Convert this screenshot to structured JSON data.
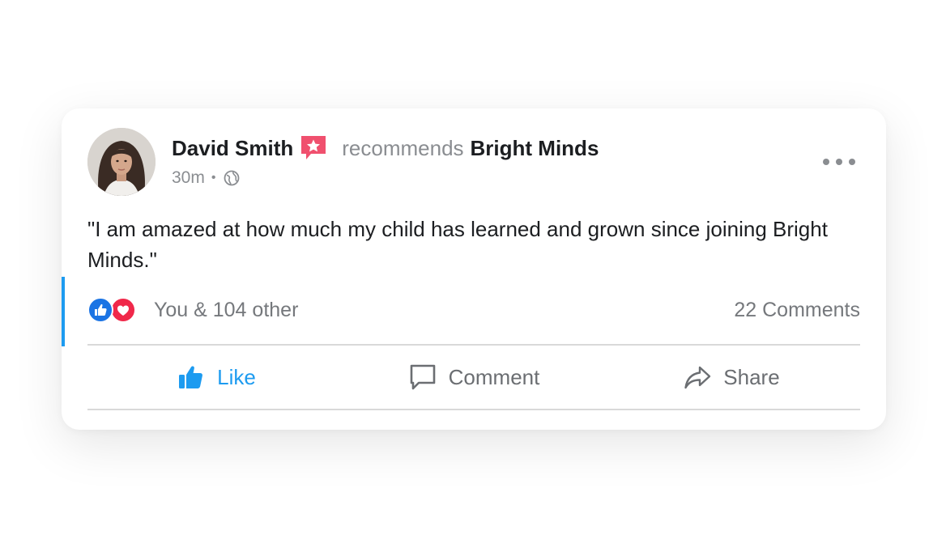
{
  "post": {
    "author": "David Smith",
    "action_text": "recommends",
    "page_name": "Bright Minds",
    "time": "30m",
    "separator": "•",
    "body": "\"I am amazed at how much my child has learned and grown since joining Bright Minds.\"",
    "reactions_summary": "You & 104 other",
    "comments_count": "22 Comments"
  },
  "actions": {
    "like": "Like",
    "comment": "Comment",
    "share": "Share"
  },
  "icons": {
    "badge": "recommend-star-icon",
    "privacy": "globe-icon",
    "more": "more-options-icon",
    "like_reaction": "like-reaction-icon",
    "love_reaction": "love-reaction-icon",
    "like_action": "thumbs-up-icon",
    "comment_action": "comment-bubble-icon",
    "share_action": "share-arrow-icon"
  },
  "colors": {
    "accent": "#1d9bf0",
    "like_reaction": "#1b74e4",
    "love_reaction": "#f0284a",
    "badge": "#f0506e",
    "muted_text": "#8a8d91"
  }
}
